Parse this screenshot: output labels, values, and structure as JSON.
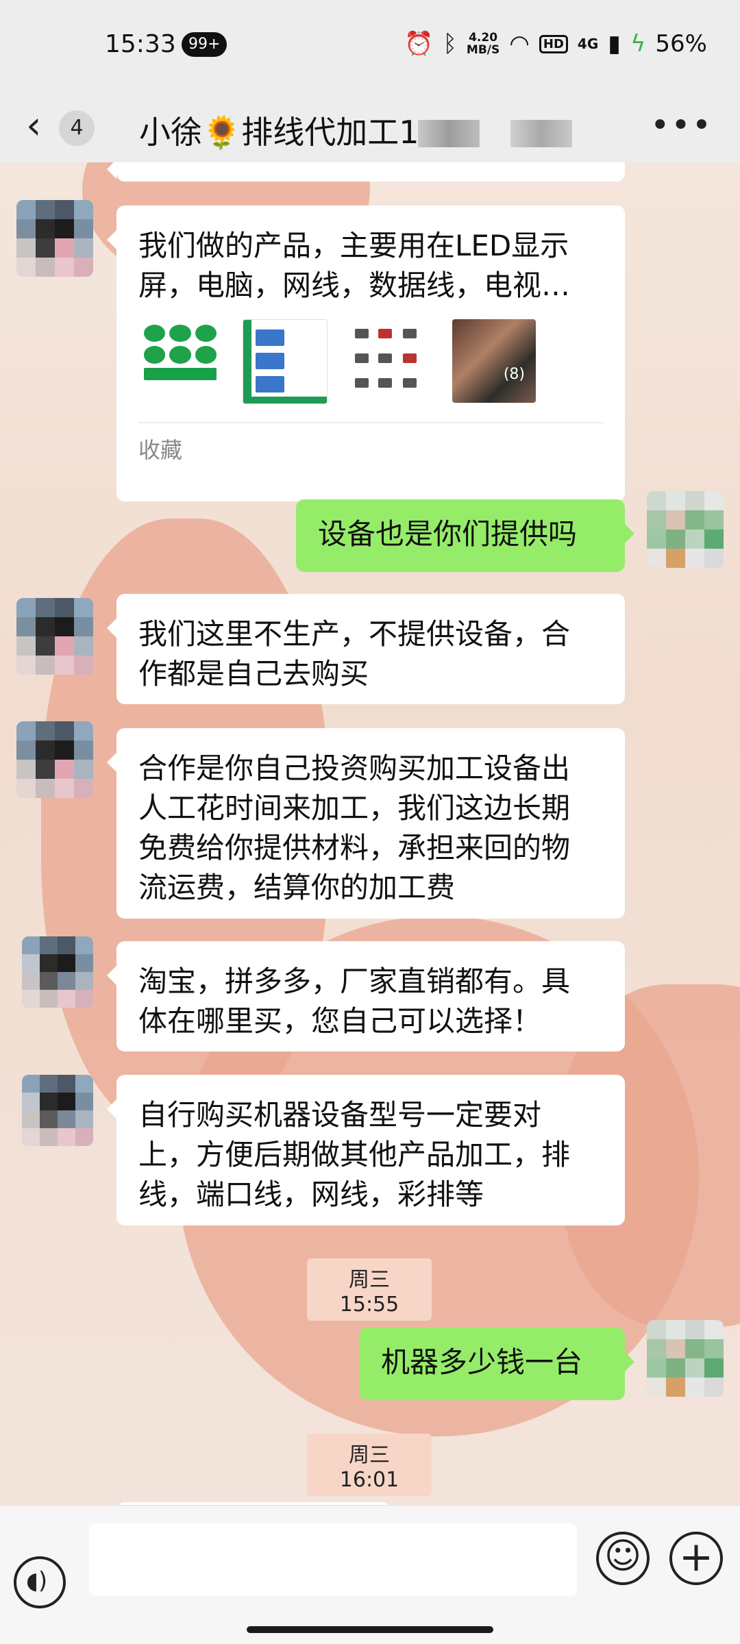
{
  "status_bar": {
    "time": "15:33",
    "badge": "99+",
    "net_speed_top": "4.20",
    "net_speed_bottom": "MB/S",
    "hd": "HD",
    "signal": "4G",
    "battery": "56%"
  },
  "header": {
    "unread_count": "4",
    "title": "小徐🌻排线代加工1",
    "more_icon": "more-icon"
  },
  "messages": [
    {
      "side": "left",
      "text_line1": "我们做的产品，主要用在LED显示",
      "text_line2": "屏，电脑，网线，数据线，电视…",
      "footer": "收藏",
      "thumb_count": "(8)"
    },
    {
      "side": "right",
      "text": "设备也是你们提供吗"
    },
    {
      "side": "left",
      "text_line1": "我们这里不生产，不提供设备，合",
      "text_line2": "作都是自己去购买"
    },
    {
      "side": "left",
      "text_line1": "合作是你自己投资购买加工设备出",
      "text_line2": "人工花时间来加工，我们这边长期",
      "text_line3": "免费给你提供材料，承担来回的物",
      "text_line4": "流运费，结算你的加工费"
    },
    {
      "side": "left",
      "text_line1": "淘宝，拼多多，厂家直销都有。具",
      "text_line2": "体在哪里买，您自己可以选择！"
    },
    {
      "side": "left",
      "text_line1": "自行购买机器设备型号一定要对",
      "text_line2": "上，方便后期做其他产品加工，排",
      "text_line3": "线，端口线，网线，彩排等"
    },
    {
      "side": "right",
      "text": "机器多少钱一台"
    }
  ],
  "time_tags": [
    "周三 15:55",
    "周三 16:01"
  ],
  "colors": {
    "my_bubble": "#95ec69",
    "their_bubble": "#ffffff",
    "bar_bg": "#ededed"
  }
}
